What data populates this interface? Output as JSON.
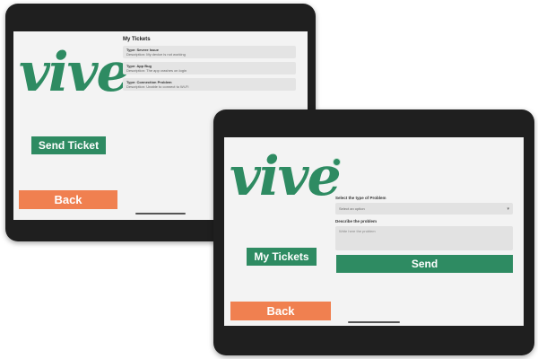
{
  "tablet_one": {
    "logo": "vive",
    "send_ticket_label": "Send Ticket",
    "back_label": "Back",
    "my_tickets_title": "My Tickets",
    "tickets": [
      {
        "type": "Type: Severe Issue",
        "description": "Description: My device is not working"
      },
      {
        "type": "Type: App Bug",
        "description": "Description: The app crashes on login"
      },
      {
        "type": "Type: Connection Problem",
        "description": "Description: Unable to connect to Wi-Fi"
      }
    ]
  },
  "tablet_two": {
    "logo": "vive",
    "my_tickets_label": "My Tickets",
    "back_label": "Back",
    "problem_type_label": "Select the type of Problem",
    "problem_type_select": "Select an option",
    "describe_label": "Describe the problem",
    "describe_placeholder": "Write here the problem",
    "send_label": "Send"
  },
  "colors": {
    "brand_green": "#2e8b62",
    "back_orange": "#f08050",
    "bezel": "#1f1f1f",
    "screen_bg": "#f3f3f3"
  },
  "icons": [
    "chevron-down-icon",
    "touch-cursor-icon"
  ]
}
